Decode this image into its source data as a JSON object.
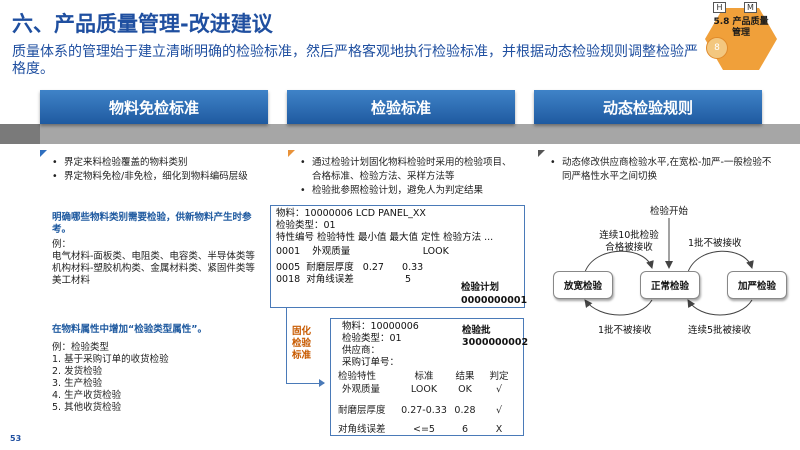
{
  "slide": {
    "title": "六、产品质量管理-改进建议",
    "subtitle": "质量体系的管理始于建立清晰明确的检验标准，然后严格客观地执行检验标准，并根据动态检验规则调整检验严格度。",
    "page_number": "53"
  },
  "badge": {
    "h": "H",
    "m": "M",
    "label_line1": "5.8 产品质量",
    "label_line2": "管理",
    "number": "8",
    "colors": {
      "hex": "#f0a03a",
      "circle": "#f3c77f"
    }
  },
  "columns": [
    {
      "header": "物料免检标准",
      "bullets": [
        "界定来料检验覆盖的物料类别",
        "界定物料免检/非免检，细化到物料编码层级"
      ]
    },
    {
      "header": "检验标准",
      "bullets": [
        "通过检验计划固化物料检验时采用的检验项目、合格标准、检验方法、采样方法等",
        "检验批参照检验计划，避免人为判定结果"
      ]
    },
    {
      "header": "动态检验规则",
      "bullets": [
        "动态修改供应商检验水平,在宽松-加严-一般检验不同严格性水平之间切换"
      ]
    }
  ],
  "left_panel": {
    "heading1": "明确哪些物料类别需要检验，供新物料产生时参考。",
    "example_label": "例：",
    "examples": [
      "电气材料-面板类、电阻类、电容类、半导体类等",
      "机构材料-塑胶机构类、金属材料类、紧固件类等",
      "美工材料"
    ],
    "heading2": "在物料属性中增加“检验类型属性”。",
    "example2_label": "例：检验类型",
    "types": [
      "1.  基于采购订单的收货检验",
      "2.  发货检验",
      "3.  生产检验",
      "4.  生产收货检验",
      "5.  其他收货检验"
    ]
  },
  "plan_box": {
    "line1": "物料：10000006 LCD PANEL_XX",
    "line2": "检验类型：01",
    "header_row": "特性编号  检验特性   最小值  最大值   定性  检验方法 ...",
    "rows": [
      "0001    外观质量                        LOOK",
      "0005  耐磨层厚度   0.27      0.33",
      "0018  对角线误差                 5"
    ],
    "plan_label": "检验计划",
    "plan_number": "0000000001"
  },
  "side_label": {
    "l1": "固化",
    "l2": "检验",
    "l3": "标准"
  },
  "lot_box": {
    "line1": "物料：10000006",
    "line2": "检验类型：01",
    "line3": "供应商：",
    "line4": "采购订单号：",
    "lot_label": "检验批",
    "lot_number": "3000000002",
    "table_header": [
      "检验特性",
      "标准",
      "结果",
      "判定"
    ],
    "table_rows": [
      [
        "外观质量",
        "LOOK",
        "OK",
        "√"
      ],
      [
        "耐磨层厚度",
        "0.27-0.33",
        "0.28",
        "√"
      ],
      [
        "对角线误差",
        "<=5",
        "6",
        "X"
      ]
    ]
  },
  "flow": {
    "start": "检验开始",
    "nodes": [
      "放宽检验",
      "正常检验",
      "加严检验"
    ],
    "top_left": "连续10批检验合格被接收",
    "top_right": "1批不被接收",
    "bottom_left": "1批不被接收",
    "bottom_right": "连续5批被接收"
  },
  "colors": {
    "title": "#1f4fa0",
    "header_gradient_top": "#3f83c8",
    "header_gradient_bottom": "#1f5aa0",
    "band": "#a6a6a6",
    "bullet_marker_1": "#2f6fbf",
    "bullet_marker_2": "#e8923a",
    "bullet_marker_3": "#555555",
    "side_label": "#c85a00"
  }
}
